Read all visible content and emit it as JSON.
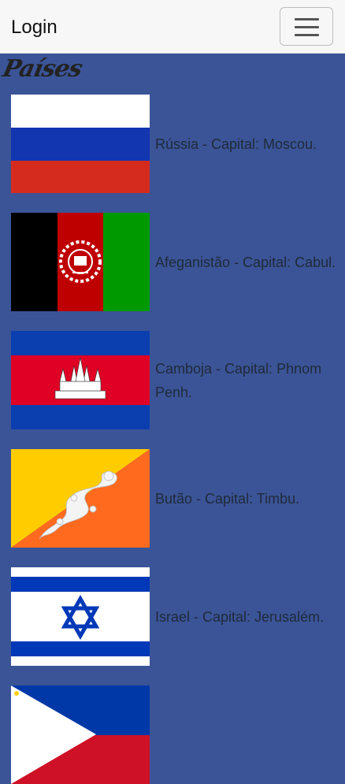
{
  "navbar": {
    "brand": "Login",
    "toggler_icon": "hamburger-menu-icon"
  },
  "heading": "Países",
  "countries": [
    {
      "caption": "Rússia - Capital: Moscou.",
      "flag_icon": "russia-flag"
    },
    {
      "caption": "Afeganistão - Capital: Cabul.",
      "flag_icon": "afghanistan-flag"
    },
    {
      "caption": "Camboja - Capital: Phnom Penh.",
      "flag_icon": "cambodia-flag"
    },
    {
      "caption": "Butão - Capital: Timbu.",
      "flag_icon": "bhutan-flag"
    },
    {
      "caption": "Israel - Capital: Jerusalém.",
      "flag_icon": "israel-flag"
    },
    {
      "caption": "",
      "flag_icon": "philippines-flag"
    }
  ],
  "colors": {
    "background": "#3b5497",
    "navbar": "#f7f7f7"
  }
}
